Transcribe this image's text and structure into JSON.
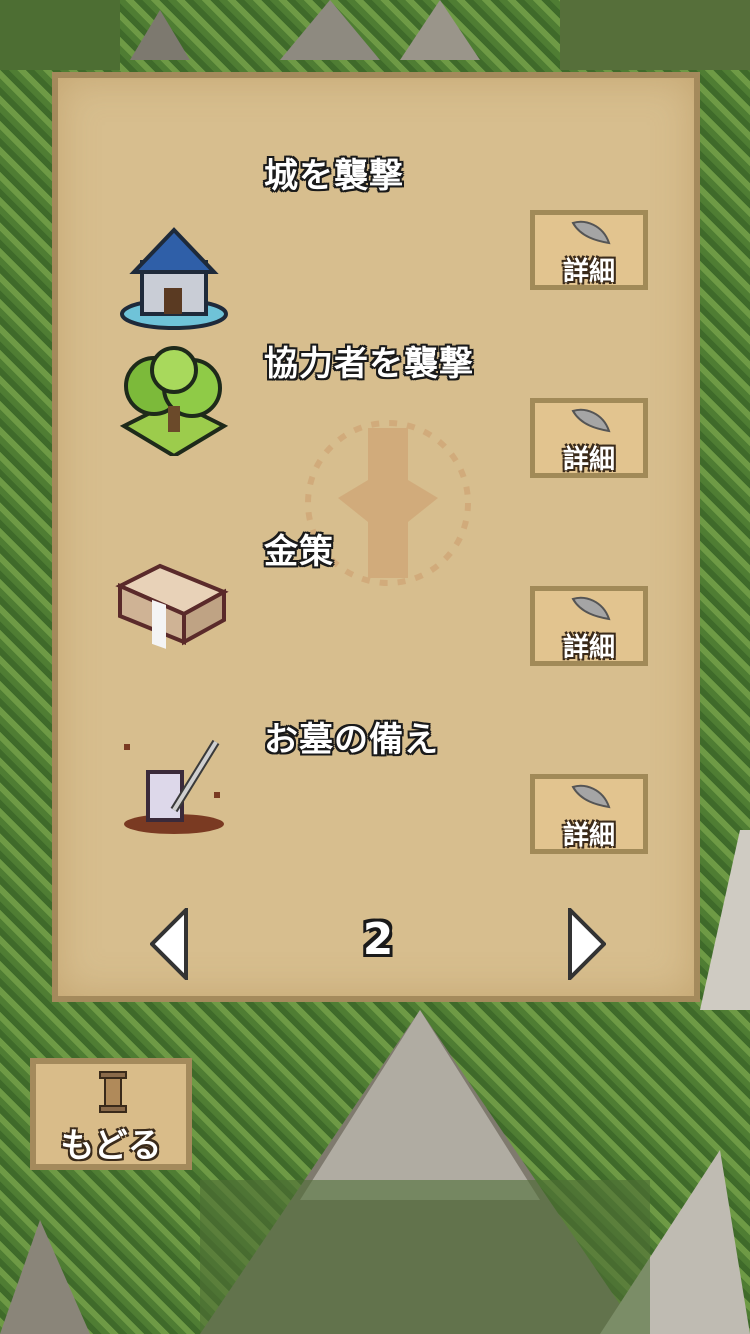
{
  "items": [
    {
      "title": "城を襲撃",
      "icon": "castle-icon",
      "detail_label": "詳細"
    },
    {
      "title": "協力者を襲撃",
      "icon": "tree-icon",
      "detail_label": "詳細"
    },
    {
      "title": "金策",
      "icon": "money-bundle-icon",
      "detail_label": "詳細"
    },
    {
      "title": "お墓の備え",
      "icon": "grave-sword-icon",
      "detail_label": "詳細"
    }
  ],
  "pager": {
    "page": "2",
    "prev_icon": "arrow-left-icon",
    "next_icon": "arrow-right-icon"
  },
  "back": {
    "label": "もどる",
    "icon": "pillar-icon"
  },
  "colors": {
    "panel": "#d7be8e",
    "panel_border": "#a48a5c",
    "button": "#e2c48f"
  }
}
